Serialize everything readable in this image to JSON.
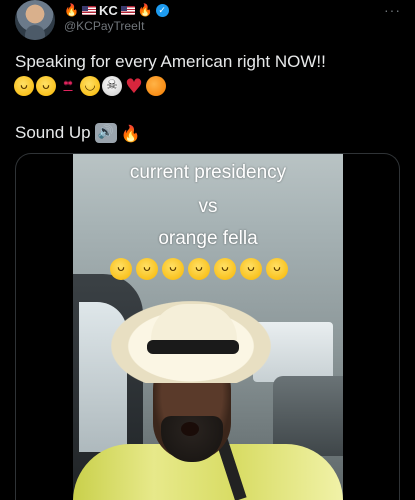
{
  "author": {
    "display_name": "KC",
    "handle": "@KCPayTreeIt",
    "verified": true,
    "name_decorations": [
      "fire",
      "us-flag",
      "us-flag",
      "fire"
    ]
  },
  "tweet": {
    "text": "Speaking for every American right NOW!!",
    "emojis": [
      "rolling-laughing",
      "tears-of-joy",
      "hundred",
      "loudly-crying",
      "skull",
      "red-heart",
      "tangerine"
    ],
    "sound_text": "Sound Up"
  },
  "video": {
    "caption_lines": [
      "current presidency",
      "vs",
      "orange fella"
    ],
    "caption_emoji_count": 7
  },
  "colors": {
    "background": "#000000",
    "text": "#e7e9ea",
    "secondary": "#71767b",
    "verified": "#1d9bf0",
    "border": "#2f3336"
  }
}
